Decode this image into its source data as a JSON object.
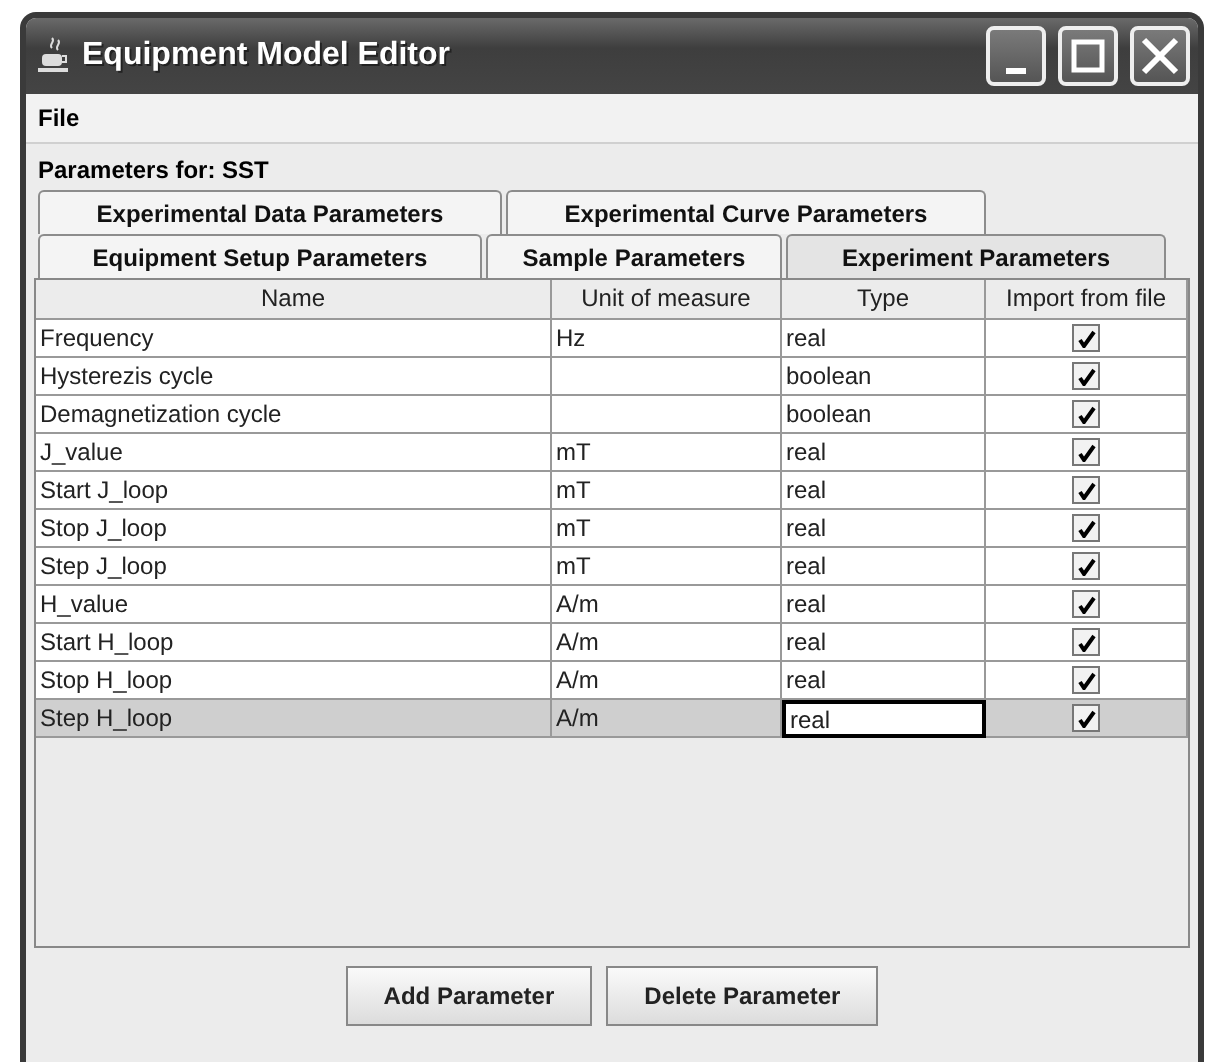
{
  "window": {
    "title": "Equipment Model Editor"
  },
  "menu": [
    "File"
  ],
  "parameters_label": "Parameters for: SST",
  "tab_rows": [
    [
      {
        "label": "Experimental Data Parameters",
        "selected": false
      },
      {
        "label": "Experimental Curve Parameters",
        "selected": false
      }
    ],
    [
      {
        "label": "Equipment Setup Parameters",
        "selected": false
      },
      {
        "label": "Sample Parameters",
        "selected": false
      },
      {
        "label": "Experiment Parameters",
        "selected": true
      }
    ]
  ],
  "table": {
    "columns": [
      "Name",
      "Unit of measure",
      "Type",
      "Import from file"
    ],
    "rows": [
      {
        "name": "Frequency",
        "unit": "Hz",
        "type": "real",
        "import": true,
        "selected": false,
        "editing": false
      },
      {
        "name": "Hysterezis cycle",
        "unit": "",
        "type": "boolean",
        "import": true,
        "selected": false,
        "editing": false
      },
      {
        "name": "Demagnetization cycle",
        "unit": "",
        "type": "boolean",
        "import": true,
        "selected": false,
        "editing": false
      },
      {
        "name": "J_value",
        "unit": "mT",
        "type": "real",
        "import": true,
        "selected": false,
        "editing": false
      },
      {
        "name": "Start J_loop",
        "unit": "mT",
        "type": "real",
        "import": true,
        "selected": false,
        "editing": false
      },
      {
        "name": "Stop J_loop",
        "unit": "mT",
        "type": "real",
        "import": true,
        "selected": false,
        "editing": false
      },
      {
        "name": "Step J_loop",
        "unit": "mT",
        "type": "real",
        "import": true,
        "selected": false,
        "editing": false
      },
      {
        "name": "H_value",
        "unit": "A/m",
        "type": "real",
        "import": true,
        "selected": false,
        "editing": false
      },
      {
        "name": "Start H_loop",
        "unit": "A/m",
        "type": "real",
        "import": true,
        "selected": false,
        "editing": false
      },
      {
        "name": "Stop H_loop",
        "unit": "A/m",
        "type": "real",
        "import": true,
        "selected": false,
        "editing": false
      },
      {
        "name": "Step H_loop",
        "unit": "A/m",
        "type": "real",
        "import": true,
        "selected": true,
        "editing": true
      }
    ]
  },
  "buttons": [
    "Add Parameter",
    "Delete Parameter"
  ]
}
